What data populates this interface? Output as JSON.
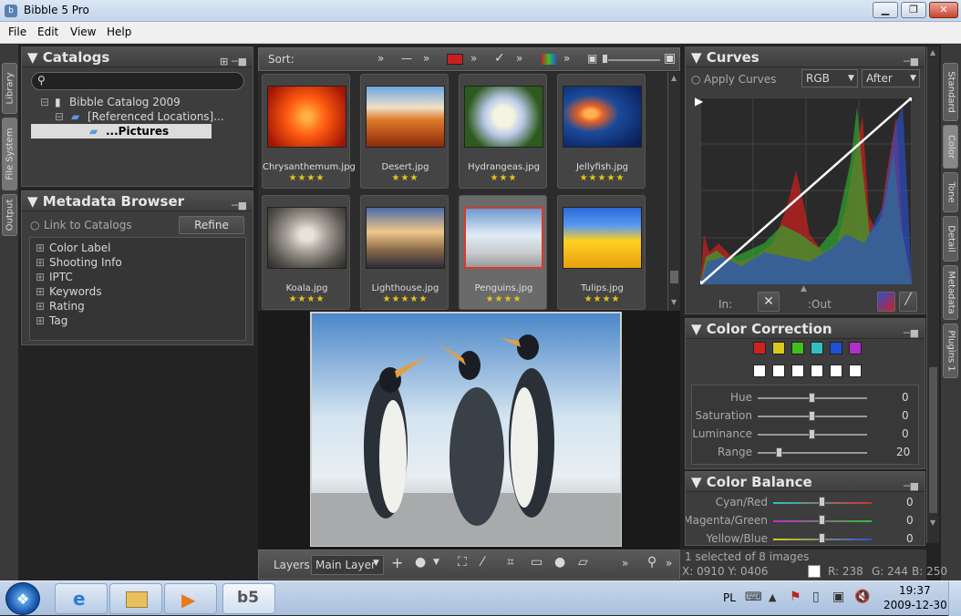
{
  "window": {
    "title": "Bibble 5 Pro",
    "icon": "bibble-app-icon"
  },
  "menu": [
    "File",
    "Edit",
    "View",
    "Help"
  ],
  "left_tabs": [
    "Library",
    "File System",
    "Output"
  ],
  "right_tabs": [
    "Standard",
    "Color",
    "Tone",
    "Detail",
    "Metadata",
    "Plugins 1"
  ],
  "catalogs": {
    "title": "Catalogs",
    "search_placeholder": "",
    "tree": [
      "Bibble Catalog 2009",
      "[Referenced Locations]...",
      "...Pictures"
    ]
  },
  "metadata_browser": {
    "title": "Metadata Browser",
    "link_label": "Link to Catalogs",
    "refine_label": "Refine",
    "items": [
      "Color Label",
      "Shooting Info",
      "IPTC",
      "Keywords",
      "Rating",
      "Tag"
    ]
  },
  "toolbar": {
    "sort_label": "Sort:",
    "chev": "»"
  },
  "thumbnails": [
    {
      "name": "Chrysanthemum.jpg",
      "stars": "★★★★",
      "c1": "#ff6a1a",
      "c2": "#b81e05"
    },
    {
      "name": "Desert.jpg",
      "stars": "★★★",
      "c1": "#f07a28",
      "c2": "#8a2a0c"
    },
    {
      "name": "Hydrangeas.jpg",
      "stars": "★★★",
      "c1": "#e6eec8",
      "c2": "#2d5a1e"
    },
    {
      "name": "Jellyfish.jpg",
      "stars": "★★★★★",
      "c1": "#e88a2a",
      "c2": "#0a2a6a"
    },
    {
      "name": "Koala.jpg",
      "stars": "★★★★",
      "c1": "#c8c4bc",
      "c2": "#5a5650"
    },
    {
      "name": "Lighthouse.jpg",
      "stars": "★★★★★",
      "c1": "#f0c88a",
      "c2": "#3a3a5a"
    },
    {
      "name": "Penguins.jpg",
      "stars": "★★★★",
      "c1": "#d8e8f4",
      "c2": "#3a4a5a"
    },
    {
      "name": "Tulips.jpg",
      "stars": "★★★★",
      "c1": "#ffd020",
      "c2": "#2a6ad8"
    }
  ],
  "bottombar": {
    "layers_label": "Layers",
    "layer_value": "Main Layer",
    "chev": "»"
  },
  "curves": {
    "title": "Curves",
    "apply_label": "Apply Curves",
    "channel": "RGB",
    "mode": "After",
    "in_label": "In:",
    "out_label": ":Out"
  },
  "color_correction": {
    "title": "Color Correction",
    "swatches": [
      "#d02020",
      "#d8c820",
      "#40c020",
      "#30c0c0",
      "#2050d8",
      "#b030c8"
    ],
    "sliders": [
      {
        "label": "Hue",
        "value": "0",
        "pos": 0.5
      },
      {
        "label": "Saturation",
        "value": "0",
        "pos": 0.5
      },
      {
        "label": "Luminance",
        "value": "0",
        "pos": 0.5
      },
      {
        "label": "Range",
        "value": "20",
        "pos": 0.2
      }
    ]
  },
  "color_balance": {
    "title": "Color Balance",
    "sliders": [
      {
        "label": "Cyan/Red",
        "value": "0",
        "pos": 0.5,
        "c1": "#30c0c0",
        "c2": "#d03030"
      },
      {
        "label": "Magenta/Green",
        "value": "0",
        "pos": 0.5,
        "c1": "#c030c0",
        "c2": "#30c030"
      },
      {
        "label": "Yellow/Blue",
        "value": "0",
        "pos": 0.5,
        "c1": "#d8c820",
        "c2": "#3050d8"
      }
    ]
  },
  "status": {
    "selected": "1 selected of 8 images",
    "coords": "X: 0910  Y: 0406",
    "r": "R: 238",
    "g": "G: 244",
    "b": "B: 250"
  },
  "taskbar": {
    "lang": "PL",
    "time": "19:37",
    "date": "2009-12-30"
  }
}
